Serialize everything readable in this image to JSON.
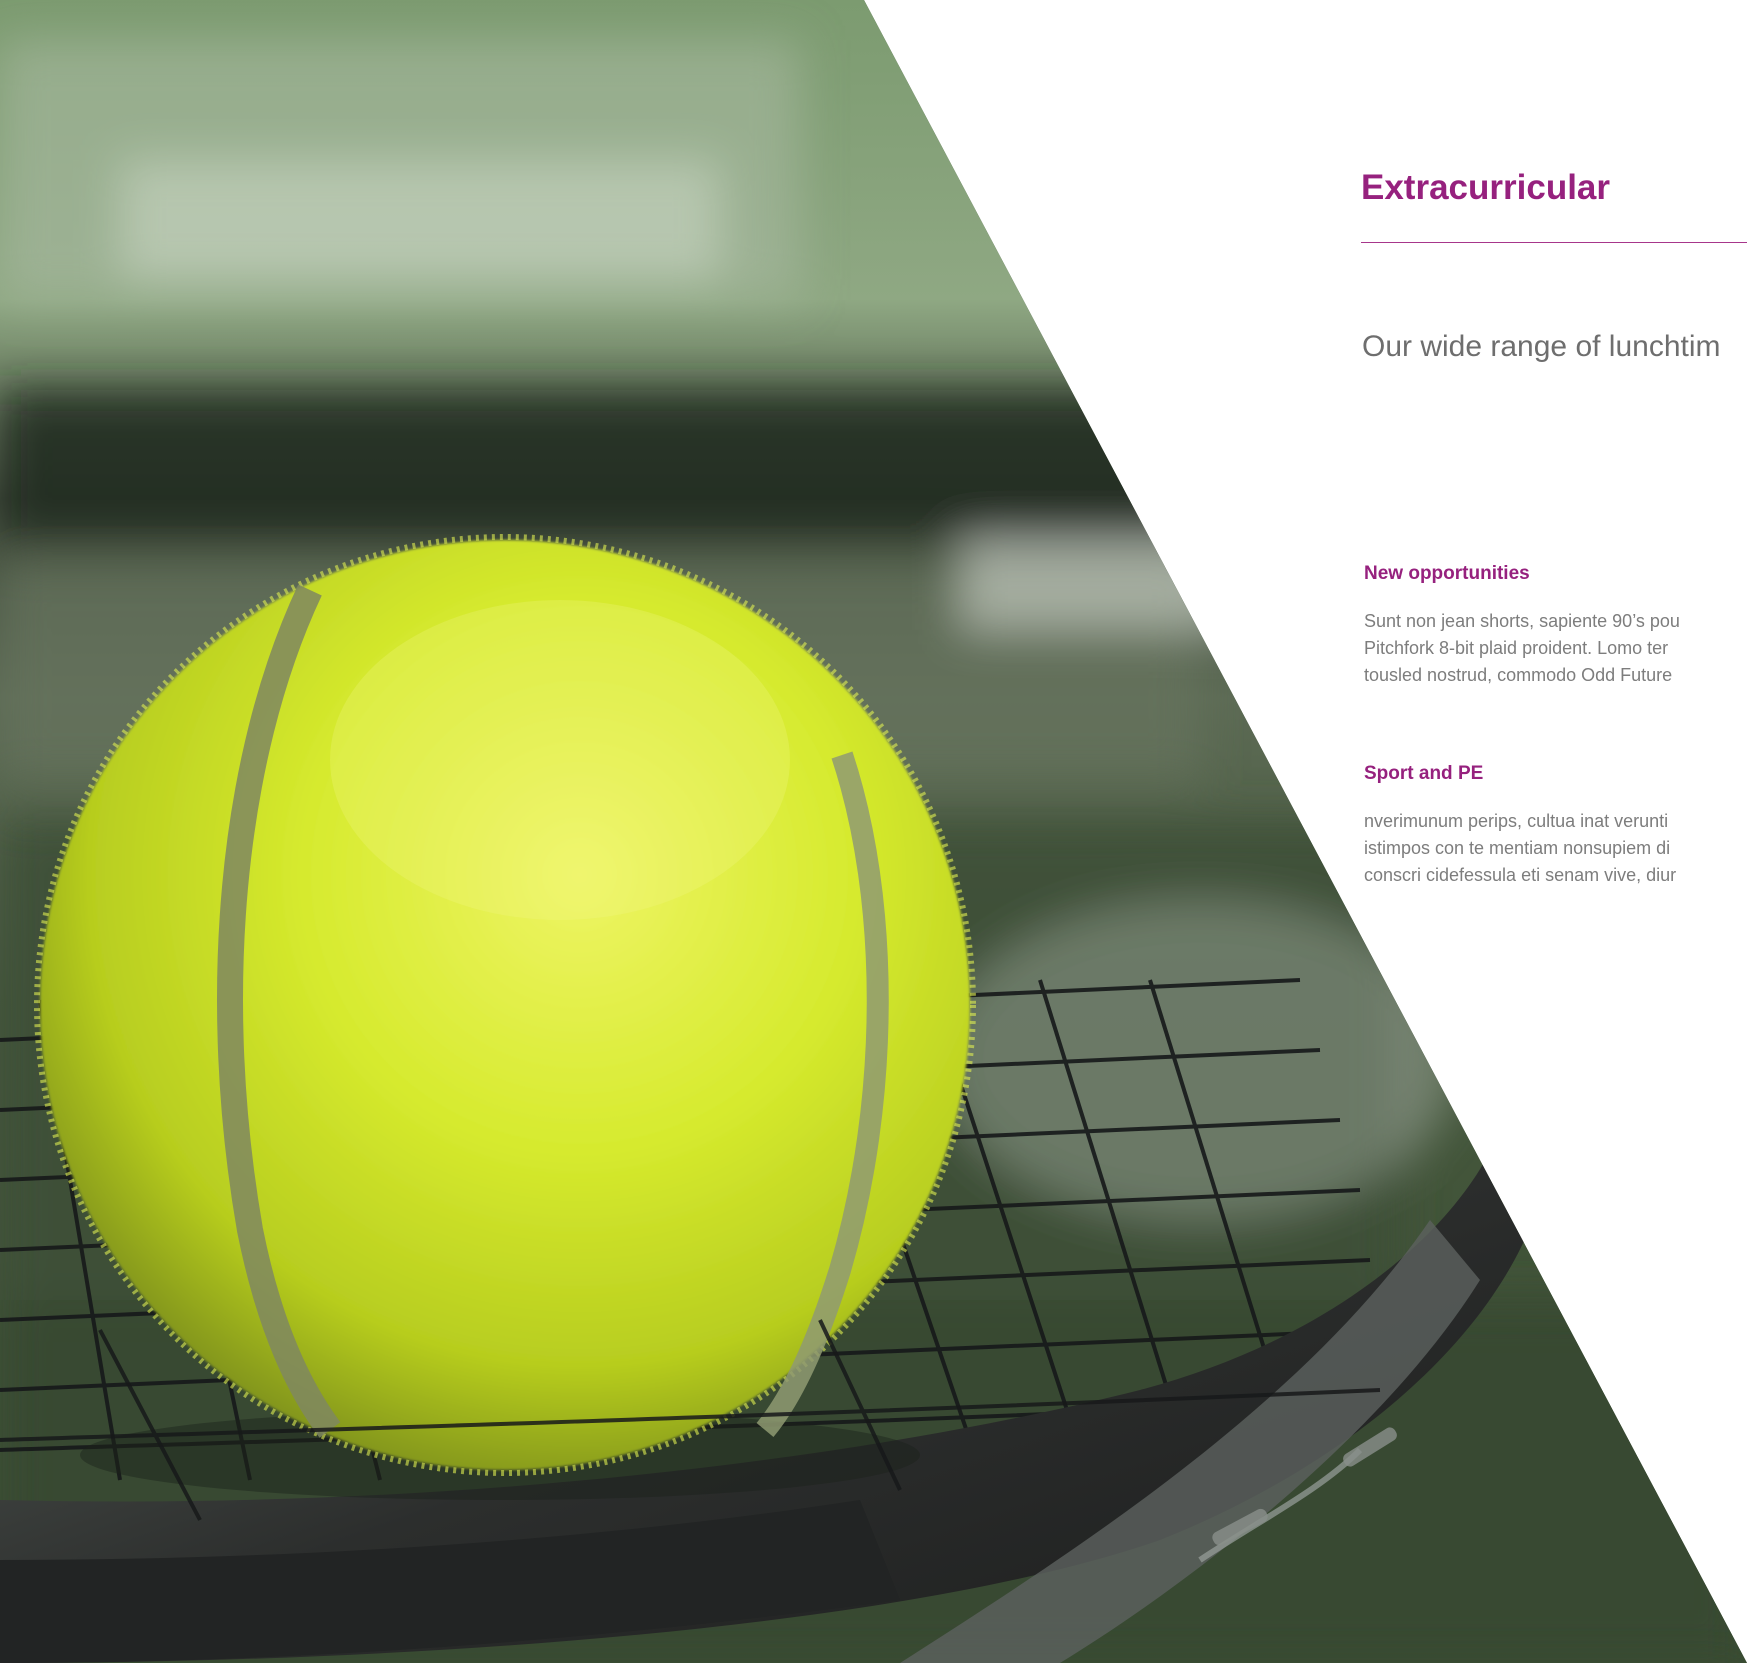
{
  "photo": {
    "subject": "tennis ball resting on tennis racket",
    "colors": {
      "ball": "#d3e832",
      "ball_shadow": "#93a81c",
      "court": "#3f5337",
      "racket": "#2b2c2c"
    }
  },
  "page": {
    "title": "Extracurricular",
    "intro": "Our wide range of lunchtim",
    "accent_color": "#96217e",
    "sections": [
      {
        "heading": "New opportunities",
        "lines": [
          "Sunt non jean shorts, sapiente 90’s pou",
          "Pitchfork 8-bit plaid proident. Lomo ter",
          "tousled nostrud, commodo Odd Future"
        ]
      },
      {
        "heading": "Sport and PE",
        "lines": [
          "nverimunum perips, cultua inat verunti",
          "istimpos con te mentiam nonsupiem di",
          "conscri cidefessula eti senam vive, diur"
        ]
      }
    ]
  }
}
